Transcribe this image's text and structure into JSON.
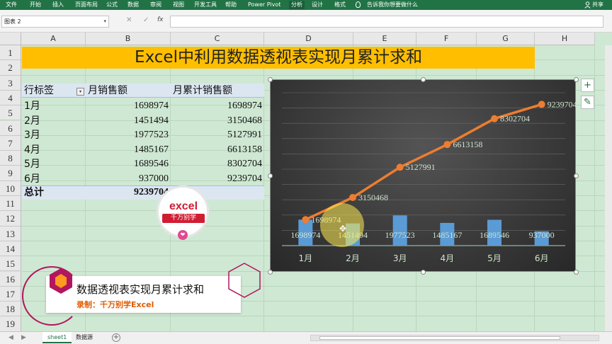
{
  "ribbon": {
    "tabs": [
      "文件",
      "开始",
      "插入",
      "页面布局",
      "公式",
      "数据",
      "审阅",
      "视图",
      "开发工具",
      "帮助",
      "Power Pivot",
      "分析",
      "设计",
      "格式"
    ],
    "active_tab": "分析",
    "tell_me": "告诉我你想要做什么",
    "share": "共享"
  },
  "formula_bar": {
    "name_box": "图表 2",
    "name_box_arrow": "▾",
    "cancel": "✕",
    "enter": "✓",
    "fx": "fx",
    "formula": ""
  },
  "sheet": {
    "columns": [
      "A",
      "B",
      "C",
      "D",
      "E",
      "F",
      "G",
      "H"
    ],
    "rows": [
      "1",
      "2",
      "3",
      "4",
      "5",
      "6",
      "7",
      "8",
      "9",
      "10",
      "11",
      "12",
      "13",
      "14",
      "15",
      "16",
      "17",
      "18",
      "19"
    ],
    "title": "Excel中利用数据透视表实现月累计求和",
    "pivot": {
      "headers": [
        "行标签",
        "月销售额",
        "月累计销售额"
      ],
      "rows": [
        {
          "label": "1月",
          "sales": "1698974",
          "cum": "1698974"
        },
        {
          "label": "2月",
          "sales": "1451494",
          "cum": "3150468"
        },
        {
          "label": "3月",
          "sales": "1977523",
          "cum": "5127991"
        },
        {
          "label": "4月",
          "sales": "1485167",
          "cum": "6613158"
        },
        {
          "label": "5月",
          "sales": "1689546",
          "cum": "8302704"
        },
        {
          "label": "6月",
          "sales": "937000",
          "cum": "9239704"
        }
      ],
      "total_label": "总计",
      "total_value": "9239704",
      "filter_glyph": "▾"
    }
  },
  "watermark": {
    "logo_text": "excel",
    "logo_cn": "千万别学",
    "heart": "❤",
    "line1": "数据透视表实现月累计求和",
    "line2": "录制：千万别学Excel"
  },
  "chart_data": {
    "type": "bar",
    "categories": [
      "1月",
      "2月",
      "3月",
      "4月",
      "5月",
      "6月"
    ],
    "series": [
      {
        "type": "bar",
        "values": [
          1698974,
          1451494,
          1977523,
          1485167,
          1689546,
          937000
        ],
        "color": "#5b9bd5"
      },
      {
        "type": "line",
        "values": [
          1698974,
          3150468,
          5127991,
          6613158,
          8302704,
          9239704
        ],
        "color": "#ed7d31"
      }
    ],
    "ylim": [
      0,
      10000000
    ],
    "grid": true,
    "legend": "none",
    "data_labels": true
  },
  "chart_buttons": {
    "add": "+",
    "style": "✎"
  },
  "sheet_tabs": [
    "sheet1",
    "数据源"
  ],
  "sheet_active": "sheet1",
  "sheet_nav": {
    "prev": "◀",
    "next": "▶",
    "add": "+"
  },
  "cursor_glyph": "✥"
}
